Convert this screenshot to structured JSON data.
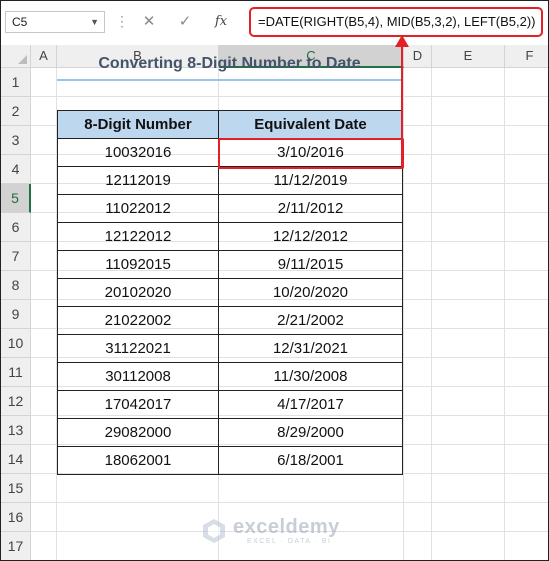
{
  "formula_bar": {
    "name_box": "C5",
    "cancel_icon": "✕",
    "enter_icon": "✓",
    "fx_label": "fx",
    "formula": "=DATE(RIGHT(B5,4), MID(B5,3,2), LEFT(B5,2))"
  },
  "columns": [
    "A",
    "B",
    "C",
    "D",
    "E",
    "F"
  ],
  "rows": [
    "1",
    "2",
    "3",
    "4",
    "5",
    "6",
    "7",
    "8",
    "9",
    "10",
    "11",
    "12",
    "13",
    "14",
    "15",
    "16",
    "17"
  ],
  "sheet": {
    "title": "Converting 8-Digit Number to Date",
    "headers": [
      "8-Digit Number",
      "Equivalent Date"
    ],
    "data": [
      [
        "10032016",
        "3/10/2016"
      ],
      [
        "12112019",
        "11/12/2019"
      ],
      [
        "11022012",
        "2/11/2012"
      ],
      [
        "12122012",
        "12/12/2012"
      ],
      [
        "11092015",
        "9/11/2015"
      ],
      [
        "20102020",
        "10/20/2020"
      ],
      [
        "21022002",
        "2/21/2002"
      ],
      [
        "31122021",
        "12/31/2021"
      ],
      [
        "30112008",
        "11/30/2008"
      ],
      [
        "17042017",
        "4/17/2017"
      ],
      [
        "29082000",
        "8/29/2000"
      ],
      [
        "18062001",
        "6/18/2001"
      ]
    ]
  },
  "watermark": {
    "name": "exceldemy",
    "tagline": "EXCEL · DATA · BI"
  },
  "colors": {
    "highlight": "#e32025",
    "header_fill": "#bdd7ee",
    "title_text": "#44546a",
    "selection_green": "#217346"
  }
}
